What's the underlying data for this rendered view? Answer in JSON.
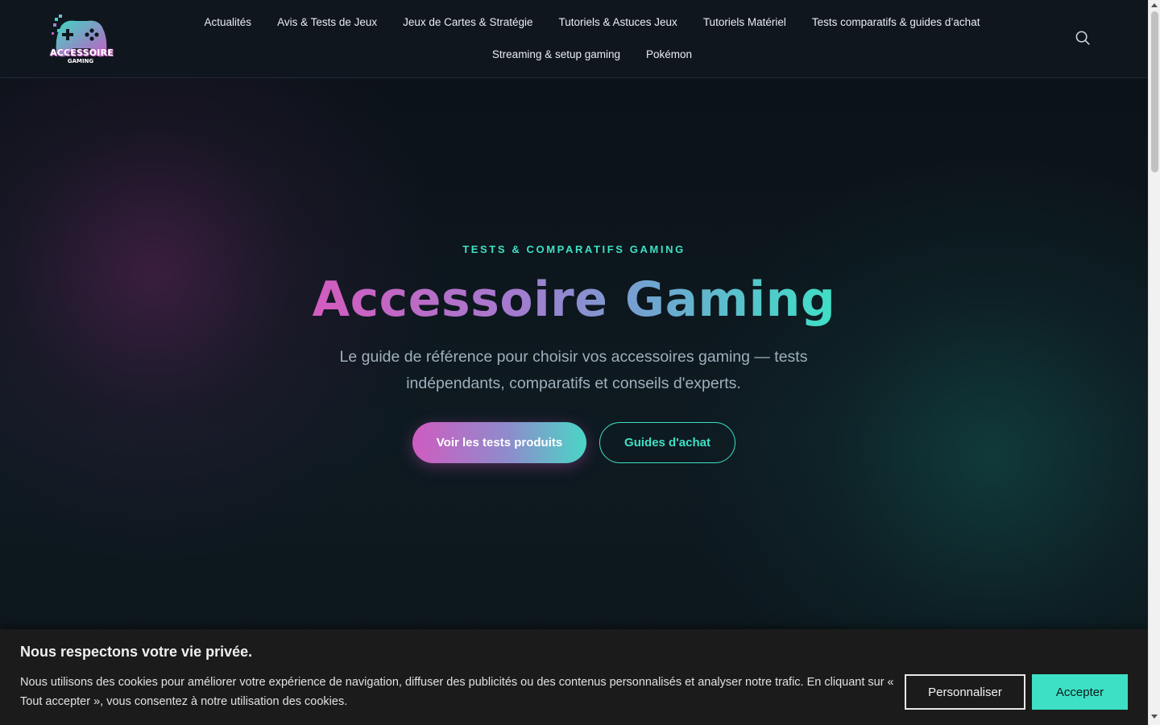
{
  "header": {
    "logo": {
      "text_main": "ACCESSOIRE",
      "text_sub": "GAMING",
      "icon": "gamepad-logo-icon"
    },
    "nav_row1": [
      {
        "label": "Actualités"
      },
      {
        "label": "Avis & Tests de Jeux"
      },
      {
        "label": "Jeux de Cartes & Stratégie"
      },
      {
        "label": "Tutoriels & Astuces Jeux"
      },
      {
        "label": "Tutoriels Matériel"
      },
      {
        "label": "Tests comparatifs & guides d’achat"
      }
    ],
    "nav_row2": [
      {
        "label": "Streaming & setup gaming"
      },
      {
        "label": "Pokémon"
      }
    ],
    "search_icon": "search-icon"
  },
  "hero": {
    "eyebrow": "TESTS & COMPARATIFS GAMING",
    "title": "Accessoire Gaming",
    "subtitle": "Le guide de référence pour choisir vos accessoires gaming — tests indépendants, comparatifs et conseils d'experts.",
    "primary_button": "Voir les tests produits",
    "secondary_button": "Guides d'achat"
  },
  "cookie_banner": {
    "title": "Nous respectons votre vie privée.",
    "text": "Nous utilisons des cookies pour améliorer votre expérience de navigation, diffuser des publicités ou des contenus personnalisés et analyser notre trafic. En cliquant sur « Tout accepter », vous consentez à notre utilisation des cookies.",
    "customize_label": "Personnaliser",
    "accept_label": "Accepter"
  },
  "colors": {
    "accent_teal": "#3ee0c5",
    "accent_pink": "#d45bbf",
    "header_bg": "#0f161d",
    "cookie_bg": "#1b1b1b"
  }
}
